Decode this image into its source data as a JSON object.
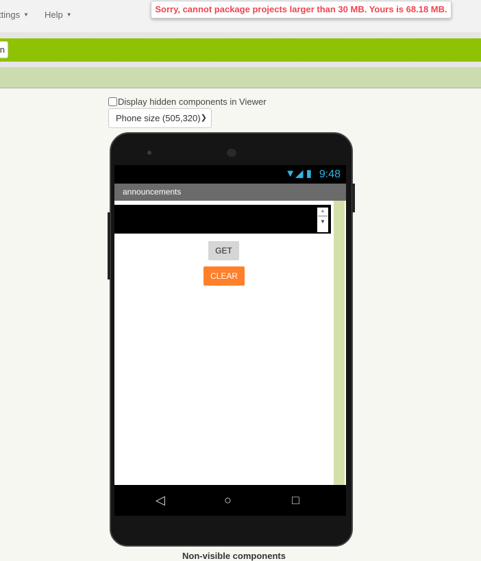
{
  "menu": {
    "settings": "ttings",
    "help": "Help"
  },
  "toast": "Sorry, cannot package projects larger than 30 MB. Yours is 68.18 MB.",
  "toolbar_button": "n",
  "viewer": {
    "hidden_checkbox_label": "Display hidden components in Viewer",
    "hidden_checked": false,
    "size_select": "Phone size (505,320)"
  },
  "phone": {
    "time": "9:48",
    "title": "announcements",
    "get_label": "GET",
    "clear_label": "CLEAR",
    "clear_color": "#ff7f2a"
  },
  "non_visible_label": "Non-visible components"
}
